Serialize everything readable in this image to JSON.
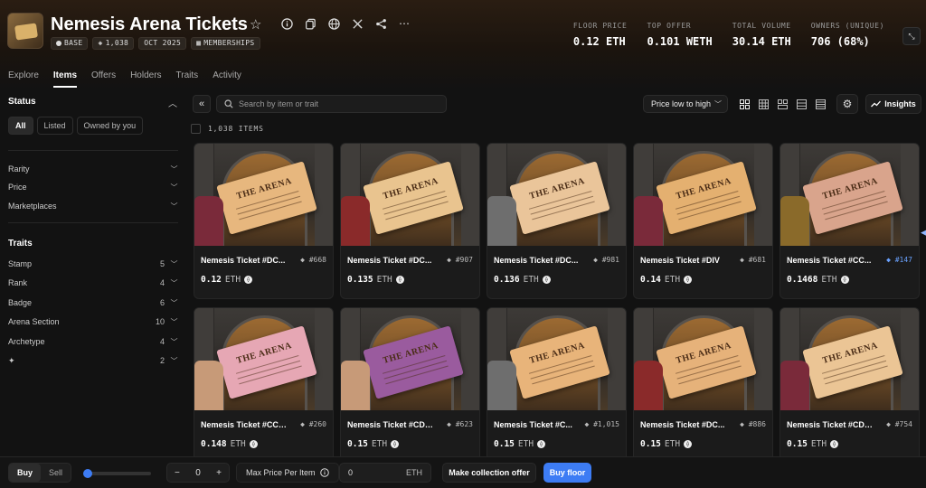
{
  "collection": {
    "title": "Nemesis Arena Tickets",
    "chain": "BASE",
    "supply": "1,038",
    "date": "OCT 2025",
    "category": "MEMBERSHIPS"
  },
  "stats": [
    {
      "label": "FLOOR PRICE",
      "value": "0.12 ETH"
    },
    {
      "label": "TOP OFFER",
      "value": "0.101 WETH"
    },
    {
      "label": "TOTAL VOLUME",
      "value": "30.14 ETH"
    },
    {
      "label": "OWNERS (UNIQUE)",
      "value": "706 (68%)"
    }
  ],
  "tabs": [
    "Explore",
    "Items",
    "Offers",
    "Holders",
    "Traits",
    "Activity"
  ],
  "sidebar": {
    "status_heading": "Status",
    "status_tabs": [
      "All",
      "Listed",
      "Owned by you"
    ],
    "filters": [
      "Rarity",
      "Price",
      "Marketplaces"
    ],
    "traits_heading": "Traits",
    "traits": [
      {
        "name": "Stamp",
        "count": "5"
      },
      {
        "name": "Rank",
        "count": "4"
      },
      {
        "name": "Badge",
        "count": "6"
      },
      {
        "name": "Arena Section",
        "count": "10"
      },
      {
        "name": "Archetype",
        "count": "4"
      },
      {
        "name": "✦",
        "count": "2"
      }
    ]
  },
  "toolbar": {
    "search_placeholder": "Search by item or trait",
    "sort_label": "Price low to high",
    "insights_label": "Insights",
    "item_count": "1,038 ITEMS"
  },
  "items": [
    {
      "name": "Nemesis Ticket #DC...",
      "token": "#668",
      "price": "0.12",
      "unit": "ETH",
      "ticket_color": "#e7b77e",
      "hand_color": "#7a2a3a",
      "highlight": false
    },
    {
      "name": "Nemesis Ticket #DC...",
      "token": "#907",
      "price": "0.135",
      "unit": "ETH",
      "ticket_color": "#e9c48f",
      "hand_color": "#8a2a2a",
      "highlight": false
    },
    {
      "name": "Nemesis Ticket #DC...",
      "token": "#981",
      "price": "0.136",
      "unit": "ETH",
      "ticket_color": "#eac59a",
      "hand_color": "#6e6e6e",
      "highlight": false
    },
    {
      "name": "Nemesis Ticket #DIV",
      "token": "#681",
      "price": "0.14",
      "unit": "ETH",
      "ticket_color": "#e4b070",
      "hand_color": "#7a2a3a",
      "highlight": false
    },
    {
      "name": "Nemesis Ticket #CC...",
      "token": "#147",
      "price": "0.1468",
      "unit": "ETH",
      "ticket_color": "#d9a48c",
      "hand_color": "#8a6a2a",
      "highlight": true
    },
    {
      "name": "Nemesis Ticket #CCX...",
      "token": "#260",
      "price": "0.148",
      "unit": "ETH",
      "ticket_color": "#e6a7b4",
      "hand_color": "#c79a78",
      "highlight": false
    },
    {
      "name": "Nemesis Ticket #CDX...",
      "token": "#623",
      "price": "0.15",
      "unit": "ETH",
      "ticket_color": "#9a5b9e",
      "hand_color": "#c79a78",
      "highlight": false
    },
    {
      "name": "Nemesis Ticket #C...",
      "token": "#1,015",
      "price": "0.15",
      "unit": "ETH",
      "ticket_color": "#e8b47a",
      "hand_color": "#6e6e6e",
      "highlight": false
    },
    {
      "name": "Nemesis Ticket #DC...",
      "token": "#886",
      "price": "0.15",
      "unit": "ETH",
      "ticket_color": "#e6b27a",
      "hand_color": "#8a2a2a",
      "highlight": false
    },
    {
      "name": "Nemesis Ticket #CDX...",
      "token": "#754",
      "price": "0.15",
      "unit": "ETH",
      "ticket_color": "#ebc595",
      "hand_color": "#7a2a3a",
      "highlight": false
    }
  ],
  "ticket_text": "THE ARENA",
  "bottombar": {
    "buy_label": "Buy",
    "sell_label": "Sell",
    "quantity": "0",
    "minus": "−",
    "plus": "+",
    "max_price_label": "Max Price Per Item",
    "max_price_value": "0",
    "max_price_unit": "ETH",
    "collection_offer_label": "Make collection offer",
    "buy_floor_label": "Buy floor"
  },
  "colors": {
    "accent": "#3d7cf4",
    "background": "#121212"
  }
}
